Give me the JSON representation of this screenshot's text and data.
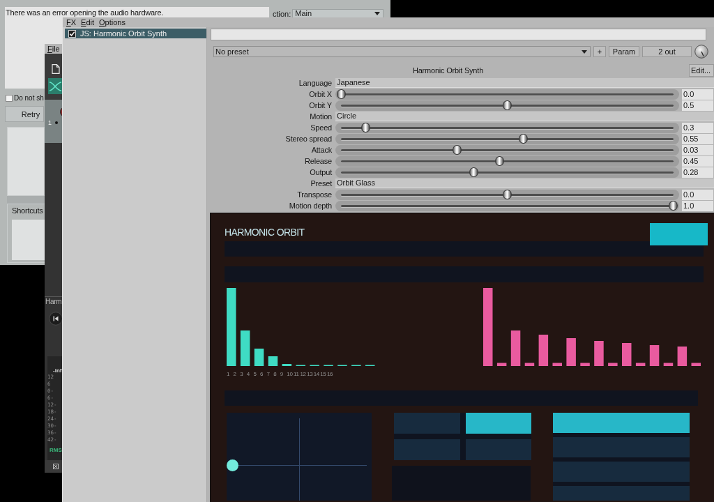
{
  "dialog": {
    "message": "There was an error opening the audio hardware.",
    "section_label": "ction:",
    "section_value": "Main",
    "dont_show": {
      "label": "Do not sh",
      "checked": false
    },
    "retry_button": "Retry",
    "shortcuts_label": "Shortcuts"
  },
  "main_window": {
    "menu": [
      "File"
    ],
    "track_number": "1",
    "track_name": "Harm",
    "meter": {
      "peak": "-inf",
      "scale": [
        "12",
        "6",
        "0-",
        "6-",
        "12-",
        "18-",
        "24-",
        "30-",
        "36-",
        "42-"
      ],
      "mode": "RMS"
    }
  },
  "fx_window": {
    "menu": [
      "FX",
      "Edit",
      "Options"
    ],
    "chain": [
      {
        "label": "JS: Harmonic Orbit Synth",
        "enabled": true,
        "selected": true
      }
    ],
    "preset": "No preset",
    "buttons": [
      "+",
      "Param",
      "2 out"
    ],
    "title": "Harmonic Orbit Synth",
    "edit_button": "Edit...",
    "params": [
      {
        "kind": "choice",
        "label": "Language",
        "value": "Japanese"
      },
      {
        "kind": "slider",
        "label": "Orbit X",
        "level": 0.0,
        "value": "0.0"
      },
      {
        "kind": "slider",
        "label": "Orbit Y",
        "level": 0.5,
        "value": "0.5"
      },
      {
        "kind": "choice",
        "label": "Motion",
        "value": "Circle"
      },
      {
        "kind": "slider",
        "label": "Speed",
        "level": 0.073,
        "value": "0.3"
      },
      {
        "kind": "slider",
        "label": "Stereo spread",
        "level": 0.548,
        "value": "0.55"
      },
      {
        "kind": "slider",
        "label": "Attack",
        "level": 0.349,
        "value": "0.03"
      },
      {
        "kind": "slider",
        "label": "Release",
        "level": 0.476,
        "value": "0.45"
      },
      {
        "kind": "slider",
        "label": "Output",
        "level": 0.4,
        "value": "0.28"
      },
      {
        "kind": "choice",
        "label": "Preset",
        "value": "Orbit Glass"
      },
      {
        "kind": "slider",
        "label": "Transpose",
        "level": 0.5,
        "value": "0.0"
      },
      {
        "kind": "slider",
        "label": "Motion depth",
        "level": 1.0,
        "value": "1.0"
      }
    ],
    "plugin_view": {
      "title": "HARMONIC ORBIT",
      "harmonic_labels": [
        "1",
        "2",
        "3",
        "4",
        "5",
        "6",
        "7",
        "8",
        "9",
        "10",
        "11",
        "12",
        "13",
        "14",
        "15",
        "16"
      ],
      "mode_tiles": [
        {
          "selected": false
        },
        {
          "selected": true
        },
        {
          "selected": false
        },
        {
          "selected": false
        }
      ],
      "list_tiles": [
        {
          "selected": true
        },
        {
          "selected": false
        },
        {
          "selected": false
        },
        {
          "selected": false
        }
      ]
    }
  }
}
